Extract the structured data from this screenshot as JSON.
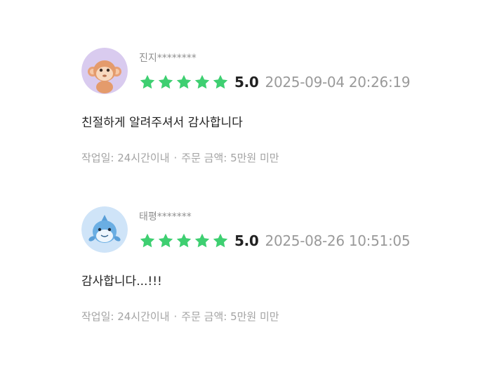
{
  "reviews": [
    {
      "avatar_icon": "monkey-icon",
      "username": "진지********",
      "stars_filled": 5,
      "star_color": "#3ecf71",
      "score": "5.0",
      "date": "2025-09-04 20:26:19",
      "comment": "친절하게 알려주셔서 감사합니다",
      "meta": {
        "work_period": "작업일: 24시간이내",
        "separator": "·",
        "order_amount": "주문 금액: 5만원 미만"
      }
    },
    {
      "avatar_icon": "dolphin-icon",
      "username": "태평*******",
      "stars_filled": 5,
      "star_color": "#3ecf71",
      "score": "5.0",
      "date": "2025-08-26 10:51:05",
      "comment": "감사합니다...!!!",
      "meta": {
        "work_period": "작업일: 24시간이내",
        "separator": "·",
        "order_amount": "주문 금액: 5만원 미만"
      }
    }
  ]
}
